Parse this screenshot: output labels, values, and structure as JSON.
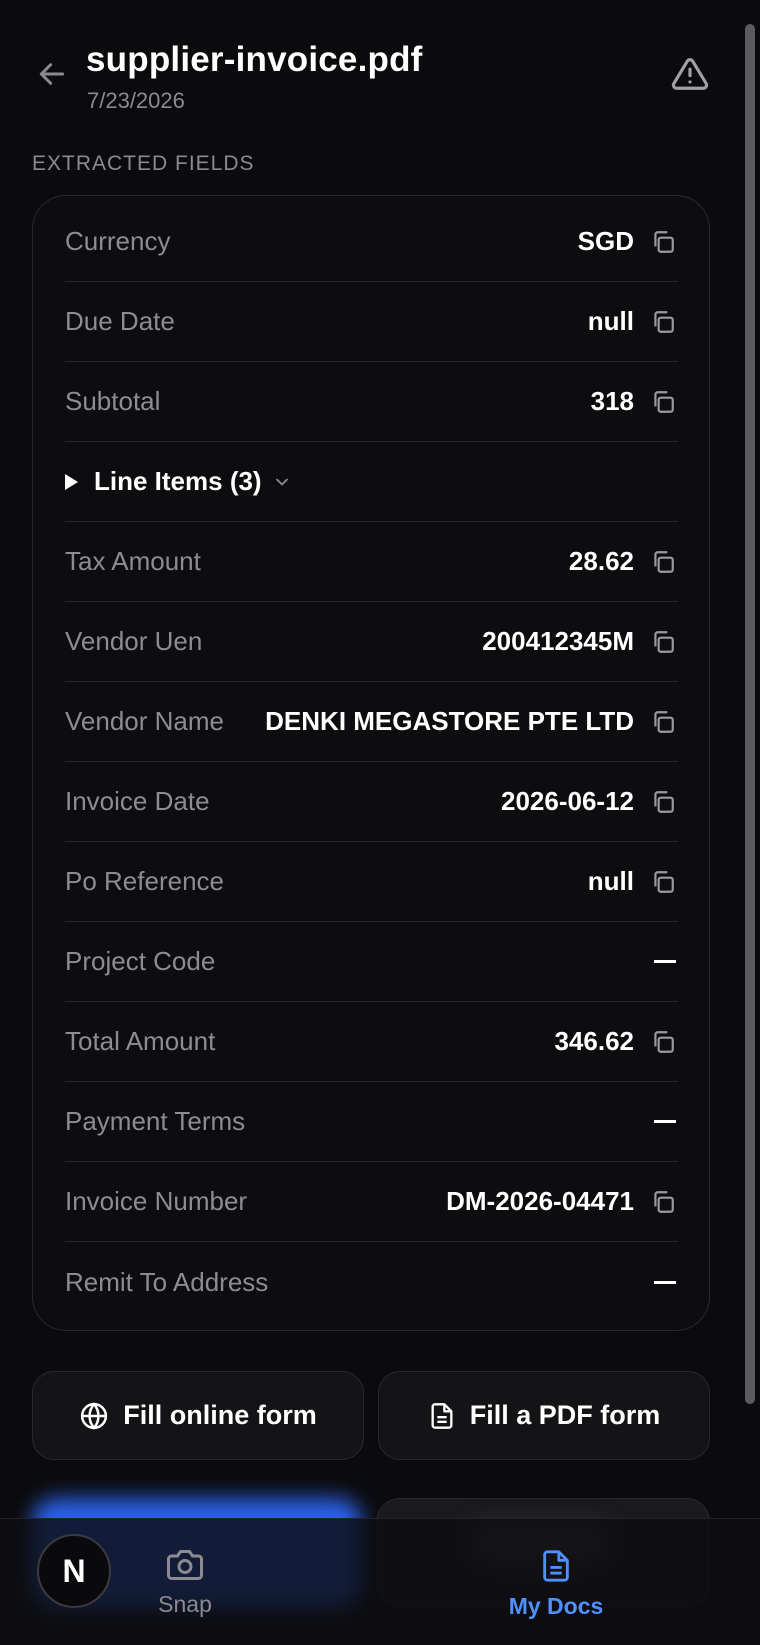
{
  "header": {
    "title": "supplier-invoice.pdf",
    "date": "7/23/2026"
  },
  "section_label": "EXTRACTED FIELDS",
  "fields": [
    {
      "label": "Currency",
      "value": "SGD",
      "copyable": true
    },
    {
      "label": "Due Date",
      "value": "null",
      "copyable": true
    },
    {
      "label": "Subtotal",
      "value": "318",
      "copyable": true
    },
    {
      "label": "Line Items (3)",
      "type": "expander"
    },
    {
      "label": "Tax Amount",
      "value": "28.62",
      "copyable": true
    },
    {
      "label": "Vendor Uen",
      "value": "200412345M",
      "copyable": true
    },
    {
      "label": "Vendor Name",
      "value": "DENKI MEGASTORE PTE LTD",
      "copyable": true
    },
    {
      "label": "Invoice Date",
      "value": "2026-06-12",
      "copyable": true
    },
    {
      "label": "Po Reference",
      "value": "null",
      "copyable": true
    },
    {
      "label": "Project Code",
      "value": "",
      "copyable": false
    },
    {
      "label": "Total Amount",
      "value": "346.62",
      "copyable": true
    },
    {
      "label": "Payment Terms",
      "value": "",
      "copyable": false
    },
    {
      "label": "Invoice Number",
      "value": "DM-2026-04471",
      "copyable": true
    },
    {
      "label": "Remit To Address",
      "value": "",
      "copyable": false
    }
  ],
  "actions": {
    "fill_online": "Fill online form",
    "fill_pdf": "Fill a PDF form"
  },
  "nav": {
    "snap": "Snap",
    "my_docs": "My Docs",
    "avatar_initial": "N"
  },
  "colors": {
    "accent": "#4f8fff",
    "primary_button": "#2f6bff",
    "background": "#0b0b0d"
  }
}
